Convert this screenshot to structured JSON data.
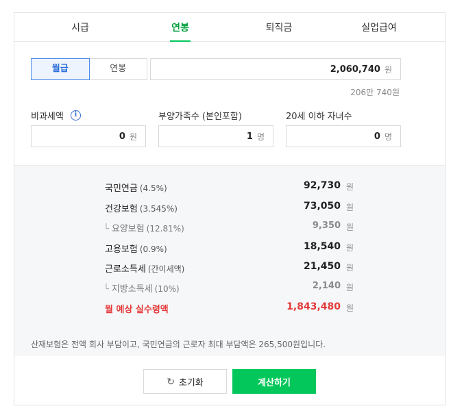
{
  "tabs": [
    {
      "label": "시급",
      "active": false
    },
    {
      "label": "연봉",
      "active": true
    },
    {
      "label": "퇴직금",
      "active": false
    },
    {
      "label": "실업급여",
      "active": false
    }
  ],
  "segment": {
    "monthly": "월급",
    "annual": "연봉",
    "selected": "월급"
  },
  "salary": {
    "value": "2,060,740",
    "unit": "원",
    "korean": "206만 740원"
  },
  "fields": {
    "nontax": {
      "label": "비과세액",
      "value": "0",
      "unit": "원"
    },
    "dependents": {
      "label": "부양가족수 (본인포함)",
      "value": "1",
      "unit": "명"
    },
    "children": {
      "label": "20세 이하 자녀수",
      "value": "0",
      "unit": "명"
    }
  },
  "results": {
    "pension": {
      "label": "국민연금",
      "pct": "(4.5%)",
      "value": "92,730",
      "unit": "원"
    },
    "health": {
      "label": "건강보험",
      "pct": "(3.545%)",
      "value": "73,050",
      "unit": "원"
    },
    "care": {
      "label": "요양보험",
      "pct": "(12.81%)",
      "value": "9,350",
      "unit": "원"
    },
    "employment": {
      "label": "고용보험",
      "pct": "(0.9%)",
      "value": "18,540",
      "unit": "원"
    },
    "income_tax": {
      "label": "근로소득세",
      "pct": "(간이세액)",
      "value": "21,450",
      "unit": "원"
    },
    "local_tax": {
      "label": "지방소득세",
      "pct": "(10%)",
      "value": "2,140",
      "unit": "원"
    },
    "net": {
      "label": "월 예상 실수령액",
      "value": "1,843,480",
      "unit": "원"
    }
  },
  "note": "산재보험은 전액 회사 부담이고, 국민연금의 근로자 최대 부담액은 265,500원입니다.",
  "buttons": {
    "reset": "초기화",
    "calculate": "계산하기"
  },
  "colors": {
    "accent": "#03c75a",
    "highlight": "#e43a3a",
    "selected_blue": "#2a6ed8"
  }
}
